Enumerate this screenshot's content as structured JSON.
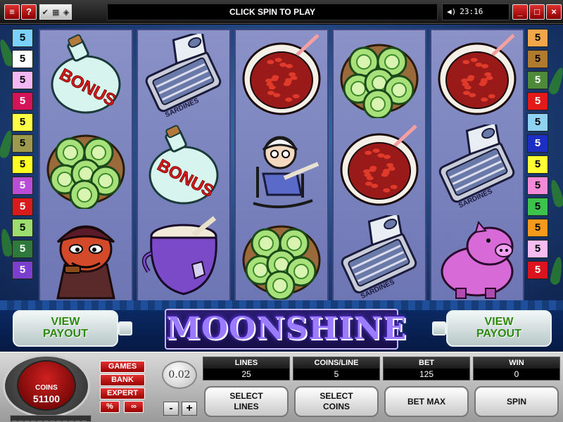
{
  "titlebar": {
    "menu_icon": "menu-icon",
    "help_label": "?",
    "tools": [
      "sound-toggle-icon",
      "settings-icon",
      "options-icon"
    ],
    "message": "CLICK SPIN TO PLAY",
    "clock": "23:16",
    "window_controls": {
      "minimize": "_",
      "maximize": "□",
      "close": "×"
    }
  },
  "paylines": {
    "left": [
      {
        "value": "5",
        "color": "#7ad3ff"
      },
      {
        "value": "5",
        "color": "#ffffff"
      },
      {
        "value": "5",
        "color": "#f4b8f4"
      },
      {
        "value": "5",
        "color": "#d4145a"
      },
      {
        "value": "5",
        "color": "#ffff44"
      },
      {
        "value": "5",
        "color": "#9e9a4c"
      },
      {
        "value": "5",
        "color": "#ffff22"
      },
      {
        "value": "5",
        "color": "#b84dd6"
      },
      {
        "value": "5",
        "color": "#d81c1c"
      },
      {
        "value": "5",
        "color": "#9adf6e"
      },
      {
        "value": "5",
        "color": "#2e7a3a"
      },
      {
        "value": "5",
        "color": "#7b3fd0"
      }
    ],
    "right": [
      {
        "value": "5",
        "color": "#f2a64a"
      },
      {
        "value": "5",
        "color": "#b07b2e"
      },
      {
        "value": "5",
        "color": "#4e8a3a"
      },
      {
        "value": "5",
        "color": "#e21a1a"
      },
      {
        "value": "5",
        "color": "#8fd2f2"
      },
      {
        "value": "5",
        "color": "#1d2fc2"
      },
      {
        "value": "5",
        "color": "#ffff33"
      },
      {
        "value": "5",
        "color": "#f48ad8"
      },
      {
        "value": "5",
        "color": "#3ec24e"
      },
      {
        "value": "5",
        "color": "#f59a1a"
      },
      {
        "value": "5",
        "color": "#f6bdf0"
      },
      {
        "value": "5",
        "color": "#d9141e"
      }
    ]
  },
  "reels": [
    [
      {
        "symbol": "bonus-jug",
        "text": "BONUS"
      },
      {
        "symbol": "green-tomatoes"
      },
      {
        "symbol": "hillbilly-with-pipe"
      }
    ],
    [
      {
        "symbol": "sardines-can",
        "text": "SARDINES"
      },
      {
        "symbol": "bonus-jug",
        "text": "BONUS"
      },
      {
        "symbol": "purple-pot"
      }
    ],
    [
      {
        "symbol": "red-beans-bowl"
      },
      {
        "symbol": "granny-rocking-chair"
      },
      {
        "symbol": "green-tomatoes"
      }
    ],
    [
      {
        "symbol": "green-tomatoes"
      },
      {
        "symbol": "red-beans-bowl"
      },
      {
        "symbol": "sardines-can",
        "text": "SARDINES"
      }
    ],
    [
      {
        "symbol": "red-beans-bowl"
      },
      {
        "symbol": "sardines-can",
        "text": "SARDINES"
      },
      {
        "symbol": "pink-pig"
      }
    ]
  ],
  "banner": {
    "logo": "MOONSHINE",
    "view_payout_left": "VIEW\nPAYOUT",
    "view_payout_right": "VIEW\nPAYOUT"
  },
  "panel": {
    "coins_label": "COINS",
    "coins_value": "51100",
    "side_buttons": {
      "games": "GAMES",
      "bank": "BANK",
      "expert": "EXPERT",
      "percent": "%",
      "autoplay": "∞"
    },
    "coin_size": "0.02",
    "minus": "-",
    "plus": "+",
    "stats": [
      {
        "label": "LINES",
        "value": "25"
      },
      {
        "label": "COINS/LINE",
        "value": "5"
      },
      {
        "label": "BET",
        "value": "125"
      },
      {
        "label": "WIN",
        "value": "0"
      }
    ],
    "actions": {
      "select_lines": "SELECT\nLINES",
      "select_coins": "SELECT\nCOINS",
      "bet_max": "BET MAX",
      "spin": "SPIN"
    }
  }
}
